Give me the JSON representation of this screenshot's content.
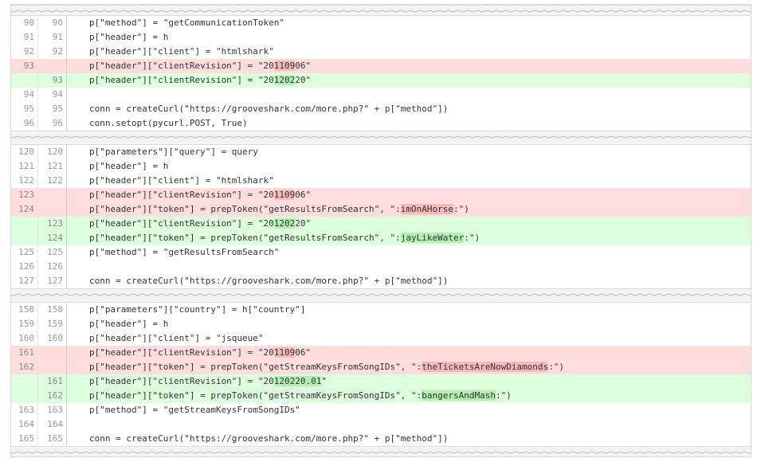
{
  "hunks": [
    {
      "lines": [
        {
          "type": "ctx",
          "old": "90",
          "new": "90",
          "segs": [
            {
              "t": "p[\"method\"] = \"getCommunicationToken\""
            }
          ]
        },
        {
          "type": "ctx",
          "old": "91",
          "new": "91",
          "segs": [
            {
              "t": "p[\"header\"] = h"
            }
          ]
        },
        {
          "type": "ctx",
          "old": "92",
          "new": "92",
          "segs": [
            {
              "t": "p[\"header\"][\"client\"] = \"htmlshark\""
            }
          ]
        },
        {
          "type": "del",
          "old": "93",
          "new": "",
          "segs": [
            {
              "t": "p[\"header\"][\"clientRevision\"] = \"20"
            },
            {
              "t": "1109",
              "h": true
            },
            {
              "t": "06\""
            }
          ]
        },
        {
          "type": "add",
          "old": "",
          "new": "93",
          "segs": [
            {
              "t": "p[\"header\"][\"clientRevision\"] = \"20"
            },
            {
              "t": "1202",
              "h": true
            },
            {
              "t": "20\""
            }
          ]
        },
        {
          "type": "ctx",
          "old": "94",
          "new": "94",
          "segs": [
            {
              "t": ""
            }
          ]
        },
        {
          "type": "ctx",
          "old": "95",
          "new": "95",
          "segs": [
            {
              "t": "conn = createCurl(\"https://grooveshark.com/more.php?\" + p[\"method\"])"
            }
          ]
        },
        {
          "type": "ctx",
          "old": "96",
          "new": "96",
          "segs": [
            {
              "t": "conn.setopt(pycurl.POST, True)"
            }
          ]
        }
      ]
    },
    {
      "lines": [
        {
          "type": "ctx",
          "old": "120",
          "new": "120",
          "segs": [
            {
              "t": "p[\"parameters\"][\"query\"] = query"
            }
          ]
        },
        {
          "type": "ctx",
          "old": "121",
          "new": "121",
          "segs": [
            {
              "t": "p[\"header\"] = h"
            }
          ]
        },
        {
          "type": "ctx",
          "old": "122",
          "new": "122",
          "segs": [
            {
              "t": "p[\"header\"][\"client\"] = \"htmlshark\""
            }
          ]
        },
        {
          "type": "del",
          "old": "123",
          "new": "",
          "segs": [
            {
              "t": "p[\"header\"][\"clientRevision\"] = \"20"
            },
            {
              "t": "1109",
              "h": true
            },
            {
              "t": "06\""
            }
          ]
        },
        {
          "type": "del",
          "old": "124",
          "new": "",
          "segs": [
            {
              "t": "p[\"header\"][\"token\"] = prepToken(\"getResultsFromSearch\", \":"
            },
            {
              "t": "imOnAHorse",
              "h": true
            },
            {
              "t": ":\")"
            }
          ]
        },
        {
          "type": "add",
          "old": "",
          "new": "123",
          "segs": [
            {
              "t": "p[\"header\"][\"clientRevision\"] = \"20"
            },
            {
              "t": "1202",
              "h": true
            },
            {
              "t": "20\""
            }
          ]
        },
        {
          "type": "add",
          "old": "",
          "new": "124",
          "segs": [
            {
              "t": "p[\"header\"][\"token\"] = prepToken(\"getResultsFromSearch\", \":"
            },
            {
              "t": "jayLikeWater",
              "h": true
            },
            {
              "t": ":\")"
            }
          ]
        },
        {
          "type": "ctx",
          "old": "125",
          "new": "125",
          "segs": [
            {
              "t": "p[\"method\"] = \"getResultsFromSearch\""
            }
          ]
        },
        {
          "type": "ctx",
          "old": "126",
          "new": "126",
          "segs": [
            {
              "t": ""
            }
          ]
        },
        {
          "type": "ctx",
          "old": "127",
          "new": "127",
          "segs": [
            {
              "t": "conn = createCurl(\"https://grooveshark.com/more.php?\" + p[\"method\"])"
            }
          ]
        }
      ]
    },
    {
      "lines": [
        {
          "type": "ctx",
          "old": "158",
          "new": "158",
          "segs": [
            {
              "t": "p[\"parameters\"][\"country\"] = h[\"country\"]"
            }
          ]
        },
        {
          "type": "ctx",
          "old": "159",
          "new": "159",
          "segs": [
            {
              "t": "p[\"header\"] = h"
            }
          ]
        },
        {
          "type": "ctx",
          "old": "160",
          "new": "160",
          "segs": [
            {
              "t": "p[\"header\"][\"client\"] = \"jsqueue\""
            }
          ]
        },
        {
          "type": "del",
          "old": "161",
          "new": "",
          "segs": [
            {
              "t": "p[\"header\"][\"clientRevision\"] = \"20"
            },
            {
              "t": "1109",
              "h": true
            },
            {
              "t": "06\""
            }
          ]
        },
        {
          "type": "del",
          "old": "162",
          "new": "",
          "segs": [
            {
              "t": "p[\"header\"][\"token\"] = prepToken(\"getStreamKeysFromSongIDs\", \":"
            },
            {
              "t": "theTicketsAreNowDiamonds",
              "h": true
            },
            {
              "t": ":\")"
            }
          ]
        },
        {
          "type": "add",
          "old": "",
          "new": "161",
          "segs": [
            {
              "t": "p[\"header\"][\"clientRevision\"] = \"20"
            },
            {
              "t": "120220.01",
              "h": true
            },
            {
              "t": "\""
            }
          ]
        },
        {
          "type": "add",
          "old": "",
          "new": "162",
          "segs": [
            {
              "t": "p[\"header\"][\"token\"] = prepToken(\"getStreamKeysFromSongIDs\", \":"
            },
            {
              "t": "bangersAndMash",
              "h": true
            },
            {
              "t": ":\")"
            }
          ]
        },
        {
          "type": "ctx",
          "old": "163",
          "new": "163",
          "segs": [
            {
              "t": "p[\"method\"] = \"getStreamKeysFromSongIDs\""
            }
          ]
        },
        {
          "type": "ctx",
          "old": "164",
          "new": "164",
          "segs": [
            {
              "t": ""
            }
          ]
        },
        {
          "type": "ctx",
          "old": "165",
          "new": "165",
          "segs": [
            {
              "t": "conn = createCurl(\"https://grooveshark.com/more.php?\" + p[\"method\"])"
            }
          ]
        }
      ]
    }
  ],
  "colors": {
    "deleted_bg": "#ffdddd",
    "added_bg": "#ddffdd",
    "deleted_highlight": "#f8b9b9",
    "added_highlight": "#b3f0b3",
    "separator_bg": "#f4f4f4"
  }
}
